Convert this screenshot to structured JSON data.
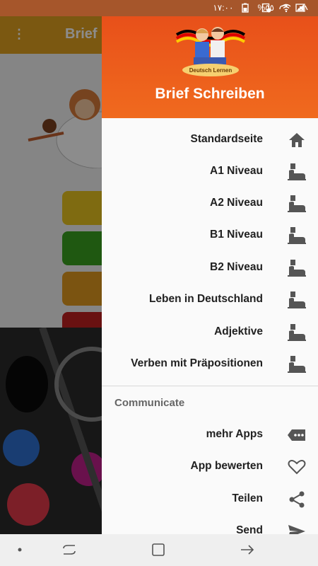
{
  "status_bar": {
    "time": "١٧:٠٠",
    "battery": "%٥٥",
    "icons": [
      "battery-icon",
      "wifi-icon",
      "mute-icon",
      "screenshot-icon",
      "link-icon",
      "gallery-icon"
    ]
  },
  "background_app": {
    "title": "Brief",
    "menu_icon": "overflow-menu-icon",
    "button_colors": [
      "#e8c420",
      "#3aa020",
      "#e09a20",
      "#c02020"
    ]
  },
  "drawer": {
    "header_title": "Brief Schreiben",
    "header_image_caption": "Deutsch Lernen",
    "items": [
      {
        "label": "Standardseite",
        "icon": "home-icon"
      },
      {
        "label": "A1 Niveau",
        "icon": "stamp-icon"
      },
      {
        "label": "A2 Niveau",
        "icon": "stamp-icon"
      },
      {
        "label": "B1 Niveau",
        "icon": "stamp-icon"
      },
      {
        "label": "B2 Niveau",
        "icon": "stamp-icon"
      },
      {
        "label": "Leben in Deutschland",
        "icon": "stamp-icon"
      },
      {
        "label": "Adjektive",
        "icon": "stamp-icon"
      },
      {
        "label": "Verben mit Präpositionen",
        "icon": "stamp-icon"
      }
    ],
    "section_title": "Communicate",
    "communicate_items": [
      {
        "label": "mehr Apps",
        "icon": "more-apps-icon"
      },
      {
        "label": "App bewerten",
        "icon": "heart-icon"
      },
      {
        "label": "Teilen",
        "icon": "share-icon"
      },
      {
        "label": "Send",
        "icon": "send-icon"
      }
    ]
  },
  "nav_bar": {
    "icons": [
      "dot-icon",
      "recents-icon",
      "home-button-icon",
      "back-icon"
    ]
  },
  "colors": {
    "header": "#e8501a",
    "status_bar": "#a6562b",
    "icon_gray": "#555555"
  }
}
